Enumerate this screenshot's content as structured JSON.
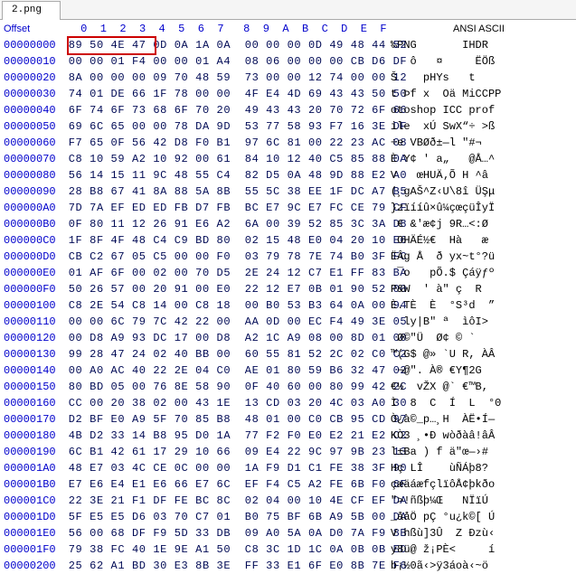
{
  "tab_title": "2.png",
  "header": {
    "offset_label": "Offset",
    "hex_cols": "  0  1  2  3  4  5  6  7   8  9  A  B  C  D  E  F",
    "ansi_label": "ANSI ASCII"
  },
  "highlight": {
    "row_index": 0,
    "bytes": "89 50 4E 47"
  },
  "rows": [
    {
      "off": "00000000",
      "hex": "89 50 4E 47 0D 0A 1A 0A  00 00 00 0D 49 48 44 52",
      "ascii": "‰PNG       IHDR"
    },
    {
      "off": "00000010",
      "hex": "00 00 01 F4 00 00 01 A4  08 06 00 00 00 CB D6 DF",
      "ascii": "   ô   ¤     ËÖß"
    },
    {
      "off": "00000020",
      "hex": "8A 00 00 00 09 70 48 59  73 00 00 12 74 00 00 12",
      "ascii": "Š    pHYs   t   "
    },
    {
      "off": "00000030",
      "hex": "74 01 DE 66 1F 78 00 00  4F E4 4D 69 43 43 50 50",
      "ascii": "t Þf x  Oä MiCCPP"
    },
    {
      "off": "00000040",
      "hex": "6F 74 6F 73 68 6F 70 20  49 43 43 20 70 72 6F 66",
      "ascii": "otoshop ICC prof"
    },
    {
      "off": "00000050",
      "hex": "69 6C 65 00 00 78 DA 9D  53 77 58 93 F7 16 3E DF",
      "ascii": "ile  xÚ SwX“÷ >ß"
    },
    {
      "off": "00000060",
      "hex": "F7 65 0F 56 42 D8 F0 B1  97 6C 81 00 22 23 AC 08",
      "ascii": "÷e VBØð±—l \"#¬ "
    },
    {
      "off": "00000070",
      "hex": "C8 10 59 A2 10 92 00 61  84 10 12 40 C5 85 88 0A",
      "ascii": "È Y¢ ' a„   @Å…^"
    },
    {
      "off": "00000080",
      "hex": "56 14 15 11 9C 48 55 C4  82 D5 0A 48 9D 88 E2 A0",
      "ascii": "V   œHUÄ‚Õ H ^â "
    },
    {
      "off": "00000090",
      "hex": "28 B8 67 41 8A 88 5A 8B  55 5C 38 EE 1F DC A7 B5",
      "ascii": "(¸gAŠ^Z‹U\\8î ÜŞμ"
    },
    {
      "off": "000000A0",
      "hex": "7D 7A EF ED ED FB D7 FB  BC E7 9C E7 FC CE 79 CF",
      "ascii": "}zïííû×û¼çœçüÎyÏ"
    },
    {
      "off": "000000B0",
      "hex": "0F 80 11 12 26 91 E6 A2  6A 00 39 52 85 3C 3A D8",
      "ascii": " € &'æ¢j 9R…<:Ø"
    },
    {
      "off": "000000C0",
      "hex": "1F 8F 4F 48 C4 C9 BD 80  02 15 48 E0 04 20 10 E6",
      "ascii": " OHÄÉ½€  Hà   æ"
    },
    {
      "off": "000000D0",
      "hex": "CB C2 67 05 C5 00 00 F0  03 79 78 7E 74 B0 3F FC",
      "ascii": "ËÂg Å  ð yx~t°?ü"
    },
    {
      "off": "000000E0",
      "hex": "01 AF 6F 00 02 00 70 D5  2E 24 12 C7 E1 FF 83 BA",
      "ascii": " ¯o   pÕ.$ Çáÿƒº"
    },
    {
      "off": "000000F0",
      "hex": "50 26 57 00 20 91 00 E0  22 12 E7 0B 01 90 52 00",
      "ascii": "P&W  ' à\" ç  R "
    },
    {
      "off": "00000100",
      "hex": "C8 2E 54 C8 14 00 C8 18  00 B0 53 B3 64 0A 00 94",
      "ascii": "È.TÈ  È  °S³d  ”"
    },
    {
      "off": "00000110",
      "hex": "00 00 6C 79 7C 42 22 00  AA 0D 00 EC F4 49 3E 05",
      "ascii": "  ly|B\" ª  ìôI> "
    },
    {
      "off": "00000120",
      "hex": "00 D8 A9 93 DC 17 00 D8  A2 1C A9 08 00 8D 01 00",
      "ascii": " Ø©\"Ü  Ø¢ © `   "
    },
    {
      "off": "00000130",
      "hex": "99 28 47 24 02 40 BB 00  60 55 81 52 2C 02 C0 C2",
      "ascii": "™(G$ @» `U R, ÀÂ"
    },
    {
      "off": "00000140",
      "hex": "00 A0 AC 40 22 2E 04 C0  AE 01 80 59 B6 32 47 02",
      "ascii": " ¬@\". À® €Y¶2G  "
    },
    {
      "off": "00000150",
      "hex": "80 BD 05 00 76 8E 58 90  0F 40 60 00 80 99 42 2C",
      "ascii": "€½  vŽX @` €™B,"
    },
    {
      "off": "00000160",
      "hex": "CC 00 20 38 02 00 43 1E  13 CD 03 20 4C 03 A0 30",
      "ascii": "Ì  8  C  Í  L  °0"
    },
    {
      "off": "00000170",
      "hex": "D2 BF E0 A9 5F 70 85 B8  48 01 00 C0 CB 95 CD 97",
      "ascii": "Ò¿à©_p…¸H  ÀË•Í—"
    },
    {
      "off": "00000180",
      "hex": "4B D2 33 14 B8 95 D0 1A  77 F2 F0 E0 E2 21 E2 C2",
      "ascii": "KÒ3 ¸•Ð wòðàâ!âÂ"
    },
    {
      "off": "00000190",
      "hex": "6C B1 42 61 17 29 10 66  09 E4 22 9C 97 9B 23 13",
      "ascii": "l±Ba ) f ä\"œ—›# "
    },
    {
      "off": "000001A0",
      "hex": "48 E7 03 4C CE 0C 00 00  1A F9 D1 C1 FE 38 3F 90",
      "ascii": "Hç LÎ    ùÑÁþ8? "
    },
    {
      "off": "000001B0",
      "hex": "E7 E6 E4 E1 E6 66 E7 6C  EF F4 C5 A2 FE 6B F0 6F",
      "ascii": "çæäáæfçlïôÅ¢þkðo"
    },
    {
      "off": "000001C0",
      "hex": "22 3E 21 F1 DF FE BC 8C  02 04 00 10 4E CF EF DA",
      "ascii": "\">!ñßþ¼Œ   NÏïÚ"
    },
    {
      "off": "000001D0",
      "hex": "5F E5 E5 D6 03 70 C7 01  B0 75 BF 6B A9 5B 00 DA",
      "ascii": "_ååÖ pÇ °u¿k©[ Ú"
    },
    {
      "off": "000001E0",
      "hex": "56 00 68 DF F9 5D 33 DB  09 A0 5A 0A D0 7A F9 8B",
      "ascii": "V hßù]3Û  Z Ðzù‹"
    },
    {
      "off": "000001F0",
      "hex": "79 38 FC 40 1E 9E A1 50  C8 3C 1D 1C 0A 0B 0B ED",
      "ascii": "y8ü@ ž¡PÈ<     í"
    },
    {
      "off": "00000200",
      "hex": "25 62 A1 BD 30 E3 8B 3E  FF 33 E1 6F E0 8B 7E F6",
      "ascii": "b¡½0ã‹>ÿ3áoà‹~ö"
    }
  ]
}
